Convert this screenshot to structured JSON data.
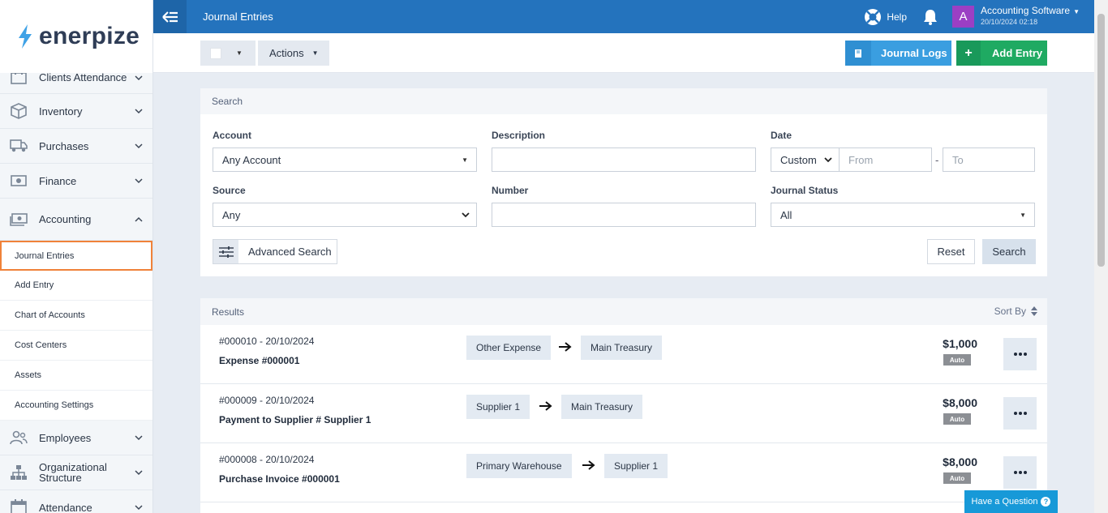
{
  "brand": {
    "name": "enerpize",
    "accent": "#2473bd",
    "bolt_color": "#3fa2e6"
  },
  "sidebar": {
    "items_top": [
      {
        "label": "Clients Attendance",
        "icon": "clients-attendance-icon"
      },
      {
        "label": "Inventory",
        "icon": "box-icon"
      },
      {
        "label": "Purchases",
        "icon": "truck-icon"
      },
      {
        "label": "Finance",
        "icon": "money-icon"
      },
      {
        "label": "Accounting",
        "icon": "cash-register-icon"
      }
    ],
    "submenu": [
      {
        "label": "Journal Entries",
        "active": true
      },
      {
        "label": "Add Entry"
      },
      {
        "label": "Chart of Accounts"
      },
      {
        "label": "Cost Centers"
      },
      {
        "label": "Assets"
      },
      {
        "label": "Accounting Settings"
      }
    ],
    "items_bottom": [
      {
        "label": "Employees",
        "icon": "users-icon"
      },
      {
        "label": "Organizational Structure",
        "icon": "org-chart-icon"
      },
      {
        "label": "Attendance",
        "icon": "calendar-icon"
      }
    ]
  },
  "topbar": {
    "title": "Journal Entries",
    "help_label": "Help",
    "avatar_letter": "A",
    "account_name": "Accounting Software",
    "account_time": "20/10/2024 02:18"
  },
  "toolbar": {
    "actions_label": "Actions",
    "journal_logs_label": "Journal Logs",
    "add_entry_label": "Add Entry"
  },
  "search": {
    "header": "Search",
    "account_label": "Account",
    "account_value": "Any Account",
    "description_label": "Description",
    "description_value": "",
    "date_label": "Date",
    "date_mode": "Custom",
    "from_placeholder": "From",
    "date_separator": "-",
    "to_placeholder": "To",
    "source_label": "Source",
    "source_value": "Any",
    "number_label": "Number",
    "number_value": "",
    "status_label": "Journal Status",
    "status_value": "All",
    "advanced_label": "Advanced Search",
    "reset_label": "Reset",
    "search_label": "Search"
  },
  "results": {
    "header": "Results",
    "sort_label": "Sort By",
    "rows": [
      {
        "number": "#000010 - 20/10/2024",
        "title": "Expense #000001",
        "from": "Other Expense",
        "to": "Main Treasury",
        "amount": "$1,000",
        "badge": "Auto"
      },
      {
        "number": "#000009 - 20/10/2024",
        "title": "Payment to Supplier # Supplier 1",
        "from": "Supplier 1",
        "to": "Main Treasury",
        "amount": "$8,000",
        "badge": "Auto"
      },
      {
        "number": "#000008 - 20/10/2024",
        "title": "Purchase Invoice #000001",
        "from": "Primary Warehouse",
        "to": "Supplier 1",
        "amount": "$8,000",
        "badge": "Auto"
      }
    ]
  },
  "help_widget": {
    "label": "Have a Question",
    "q": "?"
  }
}
